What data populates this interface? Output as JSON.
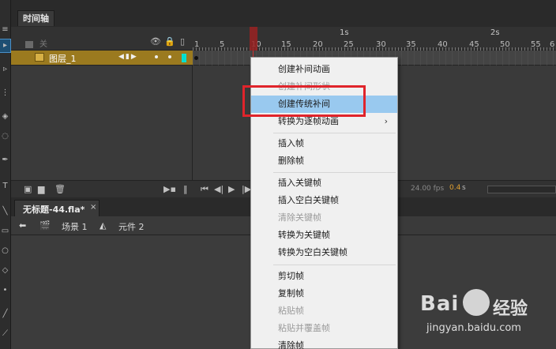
{
  "panel": {
    "timeline_tab": "时间轴"
  },
  "timeline": {
    "header_layer_label": "关",
    "eye_icon": "👁",
    "lock_icon": "🔒",
    "outline_icon": "▯",
    "seconds_marks": [
      "1s",
      "2s"
    ],
    "frame_numbers": [
      "1",
      "5",
      "10",
      "15",
      "20",
      "25",
      "30",
      "35",
      "40",
      "45",
      "50",
      "55",
      "6"
    ],
    "layer_name": "图层_1",
    "fps": "24.00 fps",
    "elapsed_value": "0.4",
    "elapsed_unit": "s"
  },
  "document": {
    "tab_title": "无标题-44.fla*",
    "close_glyph": "×",
    "scene_label": "场景 1",
    "symbol_label": "元件 2"
  },
  "context_menu": {
    "items": [
      {
        "label": "创建补间动画",
        "disabled": false
      },
      {
        "label": "创建补间形状",
        "disabled": true
      },
      {
        "label": "创建传统补间",
        "disabled": false,
        "highlighted": true
      },
      {
        "label": "转换为逐帧动画",
        "disabled": false,
        "submenu": true
      },
      {
        "label": "插入帧",
        "disabled": false
      },
      {
        "label": "删除帧",
        "disabled": false
      },
      {
        "label": "插入关键帧",
        "disabled": false
      },
      {
        "label": "插入空白关键帧",
        "disabled": false
      },
      {
        "label": "清除关键帧",
        "disabled": true
      },
      {
        "label": "转换为关键帧",
        "disabled": false
      },
      {
        "label": "转换为空白关键帧",
        "disabled": false
      },
      {
        "label": "剪切帧",
        "disabled": false
      },
      {
        "label": "复制帧",
        "disabled": false
      },
      {
        "label": "粘贴帧",
        "disabled": true
      },
      {
        "label": "粘贴并覆盖帧",
        "disabled": true
      },
      {
        "label": "清除帧",
        "disabled": false
      }
    ],
    "submenu_arrow": "›"
  },
  "watermark": {
    "logo": "Bai",
    "cn_text": "经验",
    "url": "jingyan.baidu.com"
  },
  "colors": {
    "layer_highlight": "#9b7a1f",
    "menu_highlight": "#99c9ef",
    "annotation_box": "#e0242b",
    "layer_color_swatch": "#00e0d0"
  }
}
